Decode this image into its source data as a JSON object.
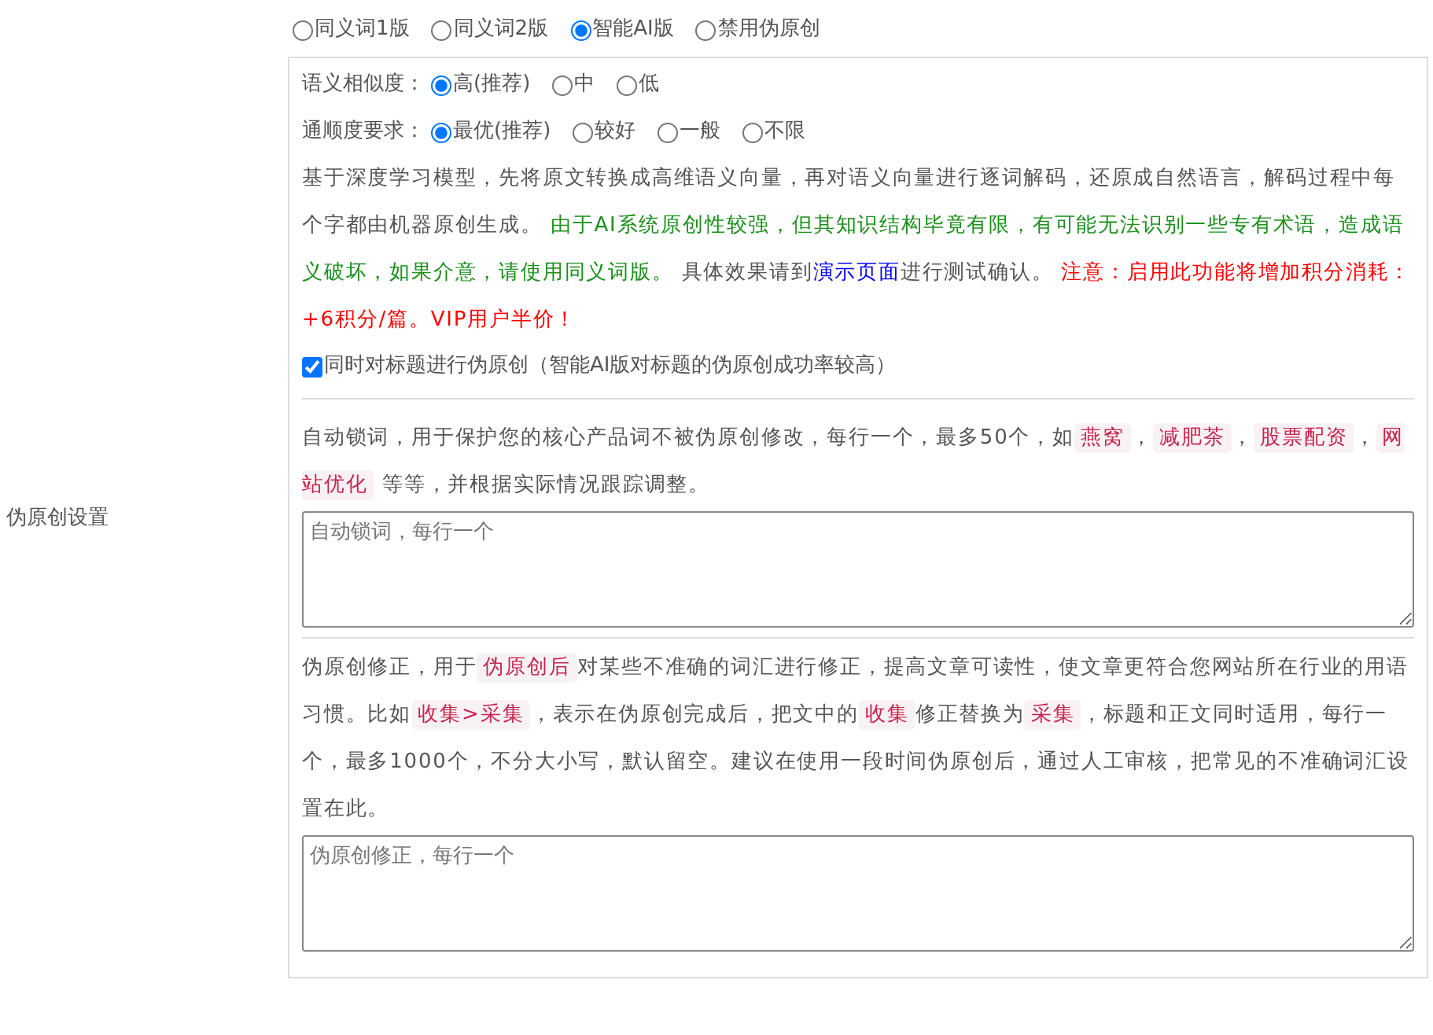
{
  "section_label": "伪原创设置",
  "modes": [
    {
      "label": "同义词1版",
      "selected": false
    },
    {
      "label": "同义词2版",
      "selected": false
    },
    {
      "label": "智能AI版",
      "selected": true
    },
    {
      "label": "禁用伪原创",
      "selected": false
    }
  ],
  "similarity": {
    "label": "语义相似度：",
    "options": [
      {
        "label": "高(推荐)",
        "selected": true
      },
      {
        "label": "中",
        "selected": false
      },
      {
        "label": "低",
        "selected": false
      }
    ]
  },
  "fluency": {
    "label": "通顺度要求：",
    "options": [
      {
        "label": "最优(推荐)",
        "selected": true
      },
      {
        "label": "较好",
        "selected": false
      },
      {
        "label": "一般",
        "selected": false
      },
      {
        "label": "不限",
        "selected": false
      }
    ]
  },
  "description": [
    {
      "kind": "plain",
      "text": "基于深度学习模型，先将原文转换成高维语义向量，再对语义向量进行逐词解码，还原成自然语言，解码过程中每个字都由机器原创生成。 "
    },
    {
      "kind": "green",
      "text": "由于AI系统原创性较强，但其知识结构毕竟有限，有可能无法识别一些专有术语，造成语义破坏，如果介意，请使用同义词版。"
    },
    {
      "kind": "plain",
      "text": " 具体效果请到"
    },
    {
      "kind": "link",
      "text": "演示页面"
    },
    {
      "kind": "plain",
      "text": "进行测试确认。 "
    },
    {
      "kind": "red",
      "text": "注意：启用此功能将增加积分消耗：+6积分/篇。VIP用户半价！"
    }
  ],
  "title_option": {
    "label": "同时对标题进行伪原创（智能AI版对标题的伪原创成功率较高）",
    "checked": true
  },
  "lock_words": {
    "description": [
      {
        "kind": "plain",
        "text": "自动锁词，用于保护您的核心产品词不被伪原创修改，每行一个，最多50个，如"
      },
      {
        "kind": "tag",
        "text": "燕窝"
      },
      {
        "kind": "plain",
        "text": "，"
      },
      {
        "kind": "tag",
        "text": "减肥茶"
      },
      {
        "kind": "plain",
        "text": "，"
      },
      {
        "kind": "tag",
        "text": "股票配资"
      },
      {
        "kind": "plain",
        "text": "，"
      },
      {
        "kind": "tag",
        "text": "网站优化"
      },
      {
        "kind": "plain",
        "text": " 等等，并根据实际情况跟踪调整。"
      }
    ],
    "placeholder": "自动锁词，每行一个"
  },
  "correction": {
    "description": [
      {
        "kind": "plain",
        "text": "伪原创修正，用于"
      },
      {
        "kind": "tag",
        "text": "伪原创后"
      },
      {
        "kind": "plain",
        "text": "对某些不准确的词汇进行修正，提高文章可读性，使文章更符合您网站所在行业的用语习惯。比如"
      },
      {
        "kind": "tag",
        "text": "收集>采集"
      },
      {
        "kind": "plain",
        "text": "，表示在伪原创完成后，把文中的"
      },
      {
        "kind": "tag",
        "text": "收集"
      },
      {
        "kind": "plain",
        "text": "修正替换为"
      },
      {
        "kind": "tag",
        "text": "采集"
      },
      {
        "kind": "plain",
        "text": "，标题和正文同时适用，每行一个，最多1000个，不分大小写，默认留空。建议在使用一段时间伪原创后，通过人工审核，把常见的不准确词汇设置在此。"
      }
    ],
    "placeholder": "伪原创修正，每行一个"
  }
}
